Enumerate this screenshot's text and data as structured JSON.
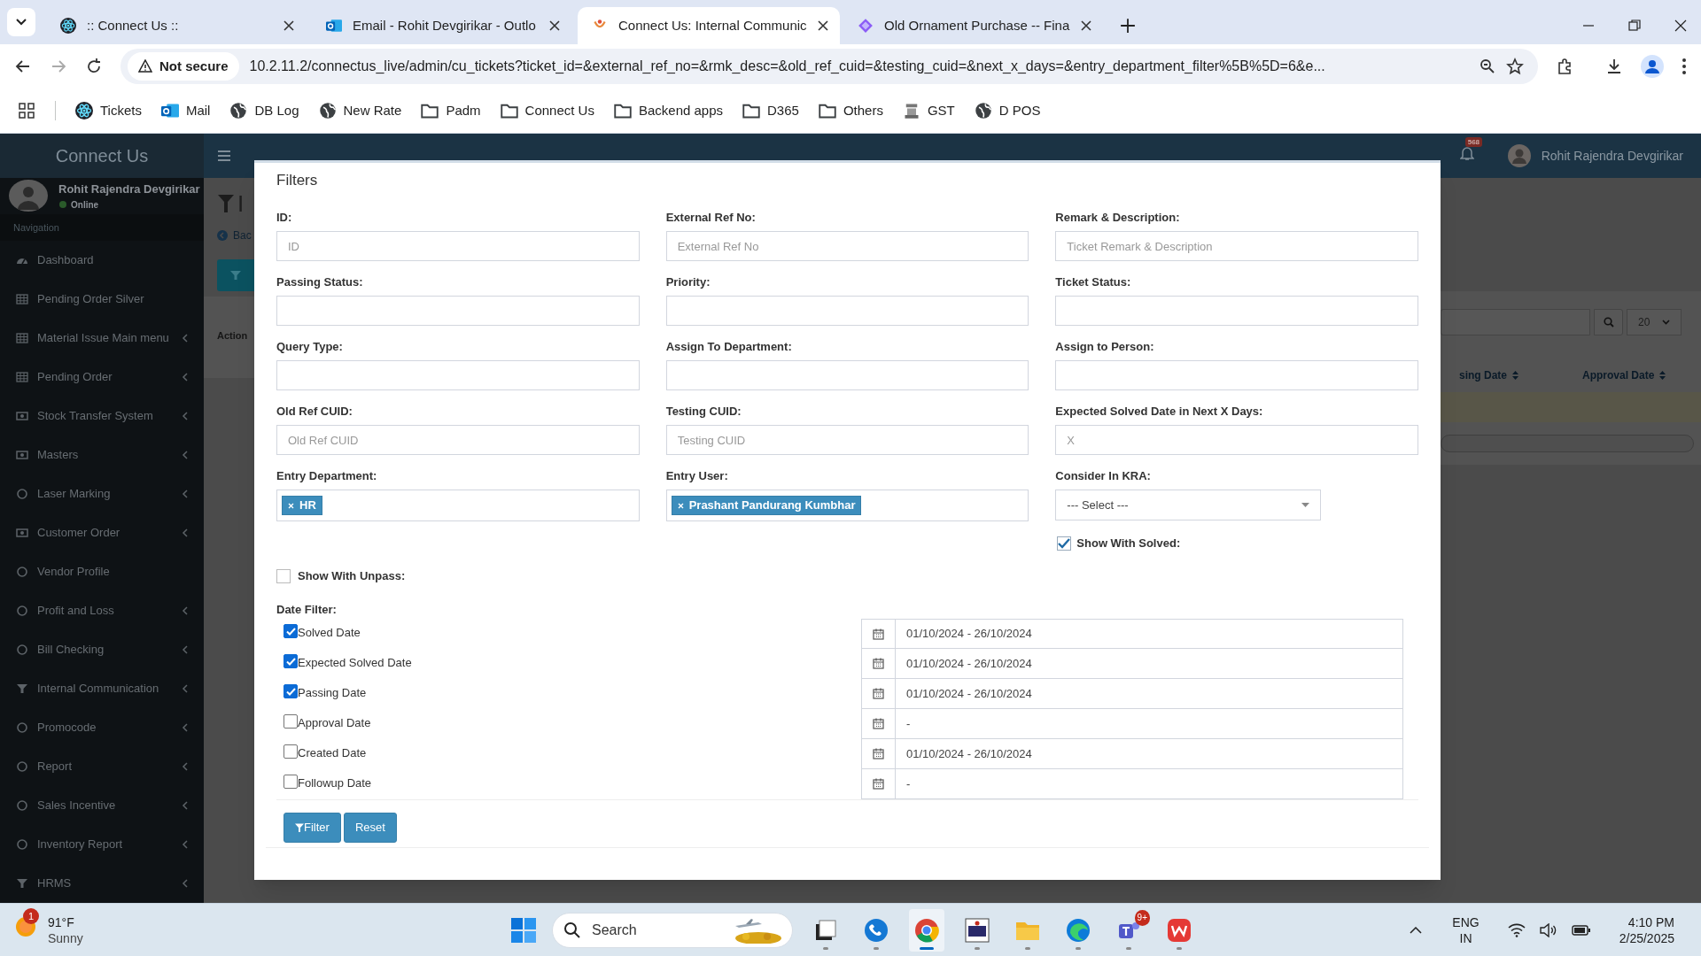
{
  "browser": {
    "tabs": [
      {
        "title": ":: Connect Us ::",
        "kind": "react",
        "selected": false
      },
      {
        "title": "Email - Rohit Devgirikar - Outlo",
        "kind": "outlook",
        "selected": false
      },
      {
        "title": "Connect Us: Internal Communic",
        "kind": "logo",
        "selected": true
      },
      {
        "title": "Old Ornament Purchase -- Fina",
        "kind": "diamond",
        "selected": false
      }
    ],
    "security": "Not secure",
    "url": "10.2.11.2/connectus_live/admin/cu_tickets?ticket_id=&external_ref_no=&rmk_desc=&old_ref_cuid=&testing_cuid=&next_x_days=&entry_department_filter%5B%5D=6&e...",
    "bookmarks": [
      {
        "label": "Tickets",
        "kind": "react"
      },
      {
        "label": "Mail",
        "kind": "outlook"
      },
      {
        "label": "DB Log",
        "kind": "globe"
      },
      {
        "label": "New Rate",
        "kind": "globe"
      },
      {
        "label": "Padm",
        "kind": "folder"
      },
      {
        "label": "Connect Us",
        "kind": "folder"
      },
      {
        "label": "Backend apps",
        "kind": "folder"
      },
      {
        "label": "D365",
        "kind": "folder"
      },
      {
        "label": "Others",
        "kind": "folder"
      },
      {
        "label": "GST",
        "kind": "emblem"
      },
      {
        "label": "D POS",
        "kind": "globe"
      }
    ]
  },
  "app": {
    "logo": "Connect Us",
    "notification_count": "568",
    "user_name": "Rohit Rajendra Devgirikar",
    "sidebar": {
      "user_name": "Rohit Rajendra Devgirikar",
      "status": "Online",
      "section": "Navigation",
      "items": [
        {
          "label": "Dashboard",
          "kind": "gauge",
          "submenu": false
        },
        {
          "label": "Pending Order Silver",
          "kind": "table",
          "submenu": false
        },
        {
          "label": "Material Issue Main menu",
          "kind": "table",
          "submenu": true
        },
        {
          "label": "Pending Order",
          "kind": "table",
          "submenu": true
        },
        {
          "label": "Stock Transfer System",
          "kind": "money",
          "submenu": true
        },
        {
          "label": "Masters",
          "kind": "money",
          "submenu": true
        },
        {
          "label": "Laser Marking",
          "kind": "circle",
          "submenu": true
        },
        {
          "label": "Customer Order",
          "kind": "money",
          "submenu": true
        },
        {
          "label": "Vendor Profile",
          "kind": "circle",
          "submenu": false
        },
        {
          "label": "Profit and Loss",
          "kind": "circle",
          "submenu": true
        },
        {
          "label": "Bill Checking",
          "kind": "circle",
          "submenu": true
        },
        {
          "label": "Internal Communication",
          "kind": "filter",
          "submenu": true
        },
        {
          "label": "Promocode",
          "kind": "circle",
          "submenu": true
        },
        {
          "label": "Report",
          "kind": "circle",
          "submenu": true
        },
        {
          "label": "Sales Incentive",
          "kind": "circle",
          "submenu": true
        },
        {
          "label": "Inventory Report",
          "kind": "circle",
          "submenu": true
        },
        {
          "label": "HRMS",
          "kind": "filter",
          "submenu": true
        }
      ]
    },
    "page": {
      "title": "I",
      "back_link": "Bac",
      "page_size": "20",
      "columns": [
        "Action",
        "sing Date",
        "Approval Date"
      ]
    }
  },
  "modal": {
    "title": "Filters",
    "fields": [
      {
        "label": "ID:",
        "kind": "text",
        "placeholder": "ID"
      },
      {
        "label": "External Ref No:",
        "kind": "text",
        "placeholder": "External Ref No"
      },
      {
        "label": "Remark & Description:",
        "kind": "text",
        "placeholder": "Ticket Remark & Description"
      },
      {
        "label": "Passing Status:",
        "kind": "text"
      },
      {
        "label": "Priority:",
        "kind": "text"
      },
      {
        "label": "Ticket Status:",
        "kind": "text"
      },
      {
        "label": "Query Type:",
        "kind": "text"
      },
      {
        "label": "Assign To Department:",
        "kind": "text"
      },
      {
        "label": "Assign to Person:",
        "kind": "text"
      },
      {
        "label": "Old Ref CUID:",
        "kind": "text",
        "placeholder": "Old Ref CUID"
      },
      {
        "label": "Testing CUID:",
        "kind": "text",
        "placeholder": "Testing CUID"
      },
      {
        "label": "Expected Solved Date in Next X Days:",
        "kind": "text",
        "placeholder": "X"
      },
      {
        "label": "Entry Department:",
        "kind": "tags",
        "tags": [
          "HR"
        ]
      },
      {
        "label": "Entry User:",
        "kind": "tags",
        "tags": [
          "Prashant Pandurang Kumbhar"
        ]
      },
      {
        "label": "Consider In KRA:",
        "kind": "select",
        "value": "--- Select ---"
      }
    ],
    "show_with_solved": {
      "label": "Show With Solved:",
      "checked": true
    },
    "show_with_unpass": {
      "label": "Show With Unpass:",
      "checked": false
    },
    "date_filter_label": "Date Filter:",
    "date_filters": [
      {
        "label": "Solved Date",
        "checked": true,
        "value": "01/10/2024 - 26/10/2024"
      },
      {
        "label": "Expected Solved Date",
        "checked": true,
        "value": "01/10/2024 - 26/10/2024"
      },
      {
        "label": "Passing Date",
        "checked": true,
        "value": "01/10/2024 - 26/10/2024"
      },
      {
        "label": "Approval Date",
        "checked": false,
        "value": "-"
      },
      {
        "label": "Created Date",
        "checked": false,
        "value": "01/10/2024 - 26/10/2024"
      },
      {
        "label": "Followup Date",
        "checked": false,
        "value": "-"
      }
    ],
    "buttons": [
      {
        "label": "Filter",
        "kind": "filter"
      },
      {
        "label": "Reset",
        "kind": "reset"
      }
    ]
  },
  "taskbar": {
    "temperature": "91°F",
    "condition": "Sunny",
    "weather_badge": "1",
    "search": "Search",
    "apps": [
      {
        "kind": "window",
        "selected": false
      },
      {
        "kind": "phone",
        "selected": false
      },
      {
        "kind": "chrome",
        "selected": true
      },
      {
        "kind": "vnc",
        "selected": false
      },
      {
        "kind": "folder",
        "selected": false
      },
      {
        "kind": "edge",
        "selected": false
      },
      {
        "kind": "teams",
        "selected": false,
        "badge": "9+"
      },
      {
        "kind": "wps",
        "selected": false
      }
    ],
    "language": "ENG",
    "region": "IN",
    "time": "4:10 PM",
    "date": "2/25/2025"
  }
}
